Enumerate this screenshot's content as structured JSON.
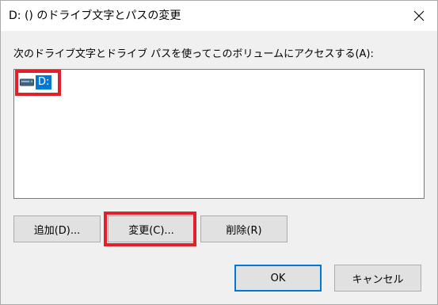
{
  "window": {
    "title": "D: () のドライブ文字とパスの変更"
  },
  "description": "次のドライブ文字とドライブ パスを使ってこのボリュームにアクセスする(A):",
  "list": {
    "items": [
      {
        "label": "D:",
        "icon": "drive-icon",
        "selected": true
      }
    ]
  },
  "buttons": {
    "add": "追加(D)...",
    "change": "変更(C)...",
    "remove": "削除(R)",
    "ok": "OK",
    "cancel": "キャンセル"
  },
  "colors": {
    "selection": "#0078d7",
    "highlight_box": "#e0202a"
  }
}
